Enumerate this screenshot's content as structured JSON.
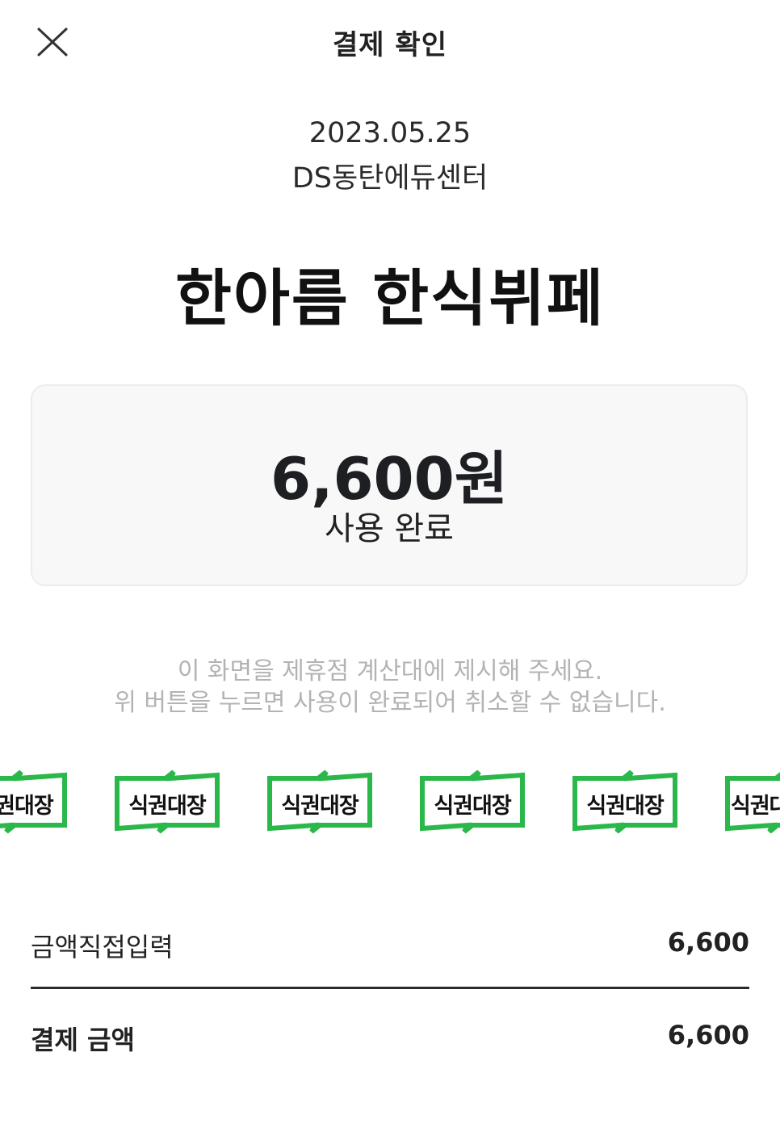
{
  "header": {
    "close_icon": "close-icon",
    "title": "결제 확인"
  },
  "receipt": {
    "date": "2023.05.25",
    "location": "DS동탄에듀센터",
    "store_name": "한아름 한식뷔페"
  },
  "amount_card": {
    "amount": "6,600원",
    "status": "사용 완료"
  },
  "notice": {
    "line1": "이 화면을 제휴점 계산대에 제시해 주세요.",
    "line2": "위 버튼을 누르면 사용이 완료되어 취소할 수 없습니다."
  },
  "stamps": {
    "label": "식권대장",
    "color": "#2bb84a"
  },
  "summary": {
    "direct_input_label": "금액직접입력",
    "direct_input_value": "6,600",
    "total_label": "결제 금액",
    "total_value": "6,600"
  }
}
